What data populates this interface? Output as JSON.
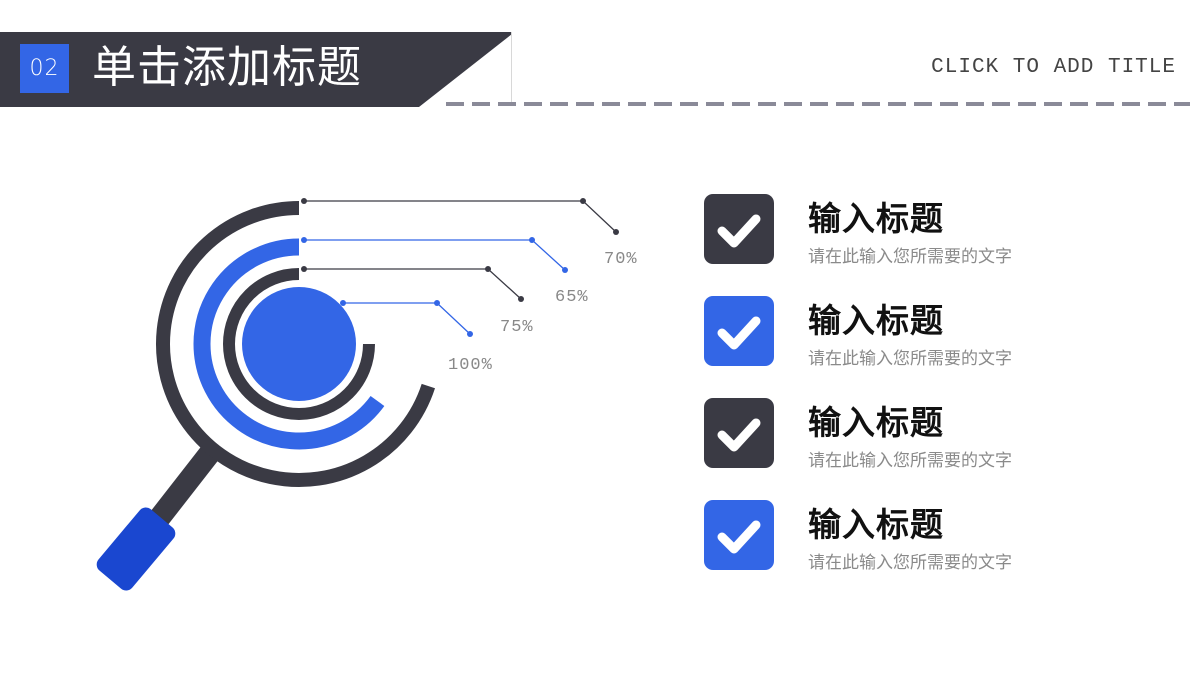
{
  "header": {
    "number": "02",
    "title": "单击添加标题",
    "subtitle": "CLICK TO ADD TITLE"
  },
  "colors": {
    "dark": "#3a3a44",
    "blue": "#3366e6",
    "handle_blue": "#1a47d0",
    "dash": "#8a8a98",
    "label": "#888888"
  },
  "chart_data": {
    "type": "radial-bar",
    "title": "",
    "series": [
      {
        "name": "ring-outer",
        "label": "70%",
        "value": 70,
        "color": "dark"
      },
      {
        "name": "ring-2",
        "label": "65%",
        "value": 65,
        "color": "blue"
      },
      {
        "name": "ring-3",
        "label": "75%",
        "value": 75,
        "color": "dark"
      },
      {
        "name": "center-circle",
        "label": "100%",
        "value": 100,
        "color": "blue"
      }
    ],
    "unit": "%",
    "max": 100
  },
  "items": [
    {
      "title": "输入标题",
      "desc": "请在此输入您所需要的文字",
      "color": "dark"
    },
    {
      "title": "输入标题",
      "desc": "请在此输入您所需要的文字",
      "color": "blue"
    },
    {
      "title": "输入标题",
      "desc": "请在此输入您所需要的文字",
      "color": "dark"
    },
    {
      "title": "输入标题",
      "desc": "请在此输入您所需要的文字",
      "color": "blue"
    }
  ]
}
